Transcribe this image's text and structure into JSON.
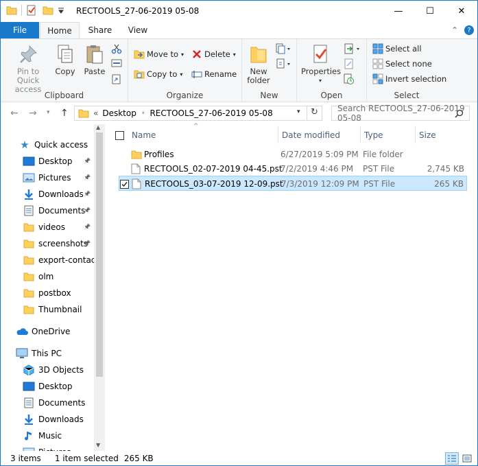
{
  "window": {
    "title": "RECTOOLS_27-06-2019 05-08",
    "minimize": "—",
    "maximize": "☐",
    "close": "✕"
  },
  "ribbon_tabs": {
    "file": "File",
    "home": "Home",
    "share": "Share",
    "view": "View",
    "collapse": "⌃",
    "help": "?"
  },
  "clipboard": {
    "pin_line1": "Pin to Quick",
    "pin_line2": "access",
    "copy": "Copy",
    "paste": "Paste",
    "group": "Clipboard"
  },
  "organize": {
    "move_to": "Move to",
    "copy_to": "Copy to",
    "delete": "Delete",
    "rename": "Rename",
    "group": "Organize"
  },
  "new": {
    "new_folder_line1": "New",
    "new_folder_line2": "folder",
    "group": "New"
  },
  "open": {
    "properties": "Properties",
    "group": "Open"
  },
  "select": {
    "select_all": "Select all",
    "select_none": "Select none",
    "invert": "Invert selection",
    "group": "Select"
  },
  "address": {
    "overflow": "«",
    "crumb1": "Desktop",
    "crumb2": "RECTOOLS_27-06-2019 05-08",
    "search_placeholder": "Search RECTOOLS_27-06-2019 05-08"
  },
  "nav_pane": {
    "quick_access": "Quick access",
    "items": [
      {
        "label": "Desktop",
        "pinned": true
      },
      {
        "label": "Pictures",
        "pinned": true
      },
      {
        "label": "Downloads",
        "pinned": true
      },
      {
        "label": "Documents",
        "pinned": true
      },
      {
        "label": "videos",
        "pinned": true
      },
      {
        "label": "screenshots",
        "pinned": true
      },
      {
        "label": "export-contacts",
        "pinned": false
      },
      {
        "label": "olm",
        "pinned": false
      },
      {
        "label": "postbox",
        "pinned": false
      },
      {
        "label": "Thumbnail",
        "pinned": false
      }
    ],
    "onedrive": "OneDrive",
    "this_pc": "This PC",
    "pc_items": [
      "3D Objects",
      "Desktop",
      "Documents",
      "Downloads",
      "Music",
      "Pictures"
    ]
  },
  "columns": {
    "name": "Name",
    "date_modified": "Date modified",
    "type": "Type",
    "size": "Size"
  },
  "files": [
    {
      "name": "Profiles",
      "date": "6/27/2019 5:09 PM",
      "type": "File folder",
      "size": ""
    },
    {
      "name": "RECTOOLS_02-07-2019 04-45.pst",
      "date": "7/2/2019 4:46 PM",
      "type": "PST File",
      "size": "2,745 KB"
    },
    {
      "name": "RECTOOLS_03-07-2019 12-09.pst",
      "date": "7/3/2019 12:09 PM",
      "type": "PST File",
      "size": "265 KB"
    }
  ],
  "status": {
    "items": "3 items",
    "selected": "1 item selected",
    "selected_size": "265 KB"
  },
  "colors": {
    "accent": "#1979ca",
    "folder": "#ffd15c",
    "selection": "#cce8ff"
  }
}
